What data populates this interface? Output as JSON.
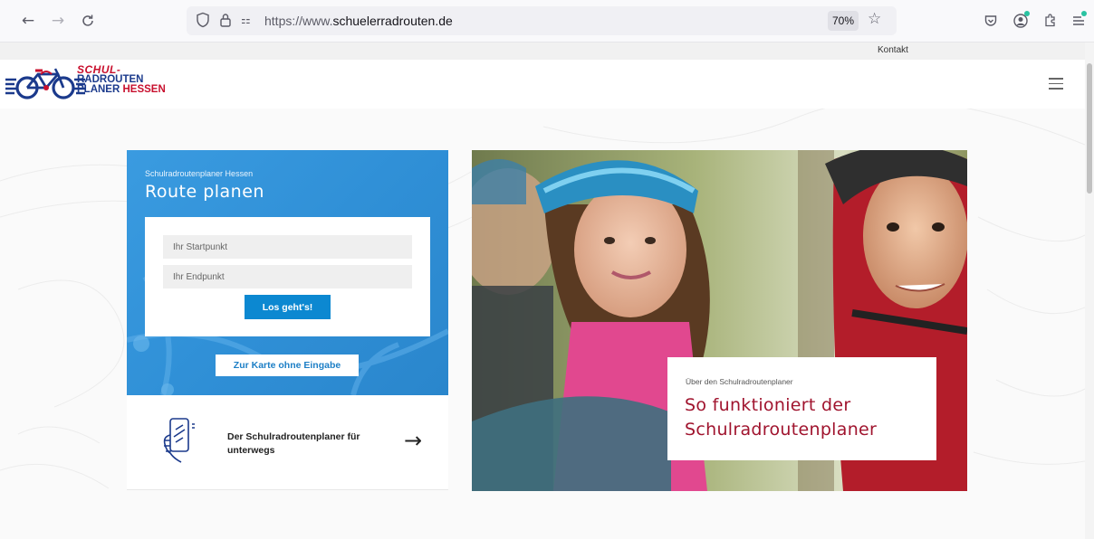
{
  "browser": {
    "url_prefix": "https://www.",
    "url_domain": "schuelerradrouten.de",
    "zoom": "70%"
  },
  "site": {
    "top_link": "Kontakt",
    "logo": {
      "line1": "SCHUL-",
      "line2": "RADROUTEN",
      "line3a": "PLANER",
      "line3b": "HESSEN"
    },
    "planner": {
      "subtitle": "Schulradroutenplaner Hessen",
      "title": "Route planen",
      "start_placeholder": "Ihr Startpunkt",
      "end_placeholder": "Ihr Endpunkt",
      "go_label": "Los geht's!",
      "map_button": "Zur Karte ohne Eingabe"
    },
    "mobile": {
      "text": "Der Schulradroutenplaner für unterwegs",
      "arrow": "→"
    },
    "info": {
      "subtitle": "Über den Schulradroutenplaner",
      "title": "So funktioniert der Schulradroutenplaner"
    }
  },
  "colors": {
    "brand_red": "#c8102e",
    "brand_blue": "#1b3a8c",
    "planner_blue": "#3a9be0",
    "button_blue": "#0c88d1",
    "title_red": "#a0142e"
  }
}
